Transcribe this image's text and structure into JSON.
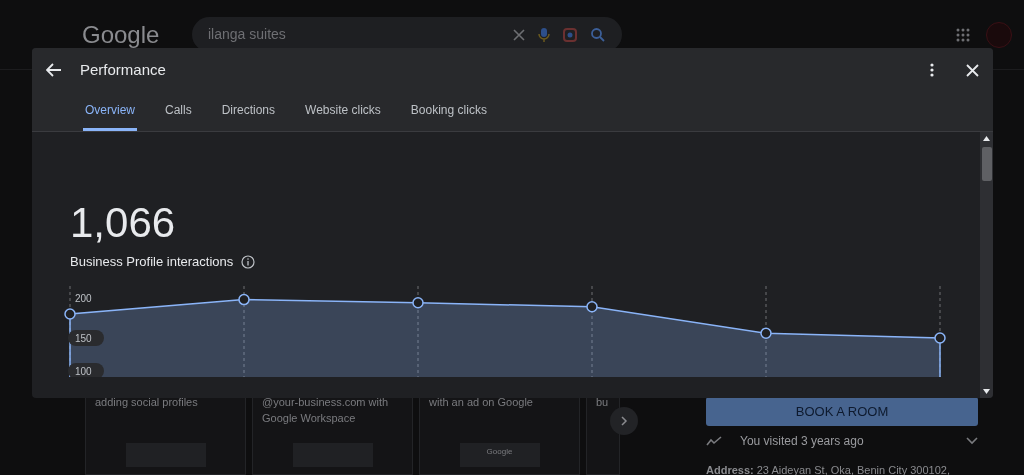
{
  "page": {
    "logo": "Google",
    "search": {
      "value": "ilanga suites"
    },
    "cards": [
      {
        "text": "adding social profiles"
      },
      {
        "text": "@your-business.com with Google Workspace"
      },
      {
        "text": "with an ad on Google",
        "image_text": "Google"
      },
      {
        "text": "bu"
      }
    ],
    "book_button": "BOOK A ROOM",
    "visited": "You visited 3 years ago",
    "address": {
      "label": "Address:",
      "value": "23 Aideyan St, Oka, Benin City 300102,"
    }
  },
  "dialog": {
    "title": "Performance",
    "tabs": [
      {
        "label": "Overview",
        "selected": true
      },
      {
        "label": "Calls",
        "selected": false
      },
      {
        "label": "Directions",
        "selected": false
      },
      {
        "label": "Website clicks",
        "selected": false
      },
      {
        "label": "Booking clicks",
        "selected": false
      }
    ],
    "total": "1,066",
    "chart_data": {
      "type": "area",
      "categories": [
        null,
        null,
        null,
        null,
        null,
        null
      ],
      "series": [
        {
          "name": "Business Profile interactions",
          "color": "#8ab4f8",
          "values": [
            180,
            198,
            194,
            189,
            156,
            150
          ]
        }
      ],
      "ylim": [
        100,
        200
      ],
      "grid": true,
      "yticks": [
        {
          "value": 100,
          "label": "100"
        },
        {
          "value": 150,
          "label": "150"
        },
        {
          "value": 200,
          "label": "200"
        }
      ]
    }
  }
}
